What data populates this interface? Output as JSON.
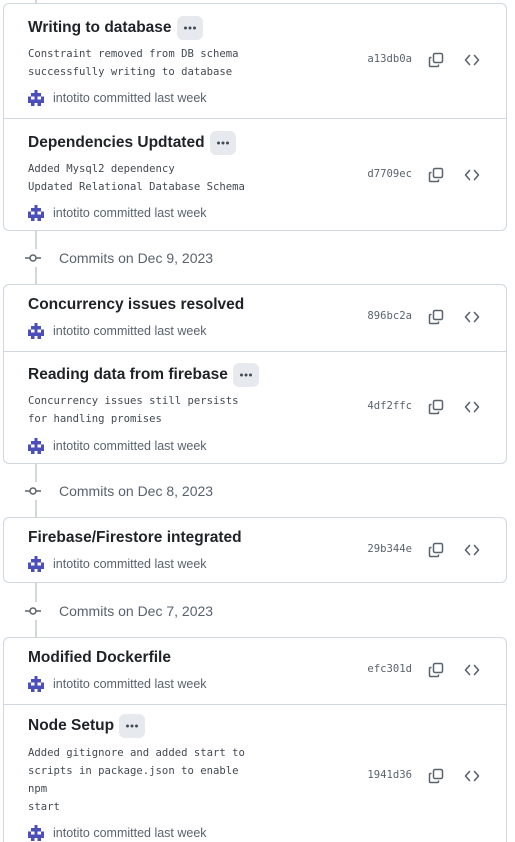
{
  "user": {
    "name": "intotito",
    "committed_suffix": "committed last week"
  },
  "icons": {
    "avatar": "identicon-avatar",
    "copy": "copy-icon",
    "browse": "code-icon",
    "ellipsis": "kebab-horizontal-icon",
    "commit": "git-commit-icon"
  },
  "colors": {
    "avatar": "#4c4fba",
    "border": "#d0d7de",
    "muted": "#59636e"
  },
  "groups": [
    {
      "commits": [
        {
          "title": "Writing to database",
          "has_description": true,
          "description": "Constraint removed from DB schema\nsuccessfully writing to database",
          "sha": "a13db0a"
        },
        {
          "title": "Dependencies Updtated",
          "has_description": true,
          "description": "Added Mysql2 dependency\nUpdated Relational Database Schema",
          "sha": "d7709ec"
        }
      ]
    },
    {
      "date_label": "Commits on Dec 9, 2023",
      "commits": [
        {
          "title": "Concurrency issues resolved",
          "has_description": false,
          "sha": "896bc2a"
        },
        {
          "title": "Reading data from firebase",
          "has_description": true,
          "description": "Concurrency issues still persists\nfor handling promises",
          "sha": "4df2ffc"
        }
      ]
    },
    {
      "date_label": "Commits on Dec 8, 2023",
      "commits": [
        {
          "title": "Firebase/Firestore integrated",
          "has_description": false,
          "sha": "29b344e"
        }
      ]
    },
    {
      "date_label": "Commits on Dec 7, 2023",
      "commits": [
        {
          "title": "Modified Dockerfile",
          "has_description": false,
          "sha": "efc301d"
        },
        {
          "title": "Node Setup",
          "has_description": true,
          "description": "Added gitignore and added start to\nscripts in package.json to enable\nnpm\nstart",
          "sha": "1941d36"
        }
      ]
    }
  ]
}
